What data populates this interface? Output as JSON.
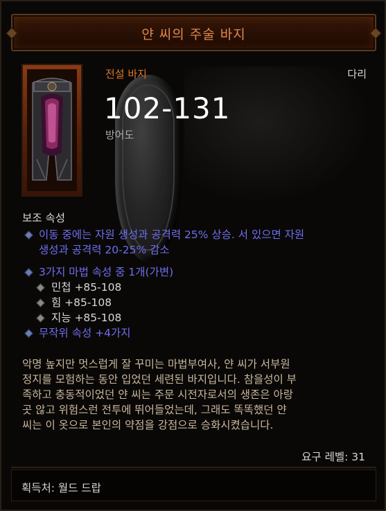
{
  "item": {
    "name": "얀 씨의 주술 바지",
    "type": "전설 바지",
    "slot": "다리",
    "armor_value": "102-131",
    "armor_label": "방어도"
  },
  "attributes": {
    "section_label": "보조 속성",
    "line1_a": "이동 중에는 자원 생성과 공격력 25% 상승. 서 있으면 자원",
    "line1_b": "생성과 공격력 20-25% 감소",
    "choose_label": "3가지 마법 속성 중 1개(가변)",
    "choices": [
      "민첩 +85-108",
      "힘 +85-108",
      "지능 +85-108"
    ],
    "random_label": "무작위 속성 +4가지"
  },
  "flavor": [
    "악명 높지만 멋스럽게 잘 꾸미는 마법부여사, 얀 씨가 서부원",
    "정지를 모험하는 동안 입었던 세련된 바지입니다. 참을성이 부",
    "족하고 충동적이었던 얀 씨는 주문 시전자로서의 생존은 아랑",
    "곳 않고 위험스런 전투에 뛰어들었는데, 그래도 똑똑했던 얀",
    "씨는 이 옷으로 본인의 약점을 강점으로 승화시켰습니다."
  ],
  "required_level": "요구 레벨: 31",
  "source": "획득처: 월드 드랍",
  "colors": {
    "legendary": "#d9772d",
    "magic_blue": "#6e6eef",
    "title": "#e0884a"
  },
  "icons": [
    "pants-item-icon",
    "shield-background-icon",
    "diamond-bullet-icon"
  ]
}
